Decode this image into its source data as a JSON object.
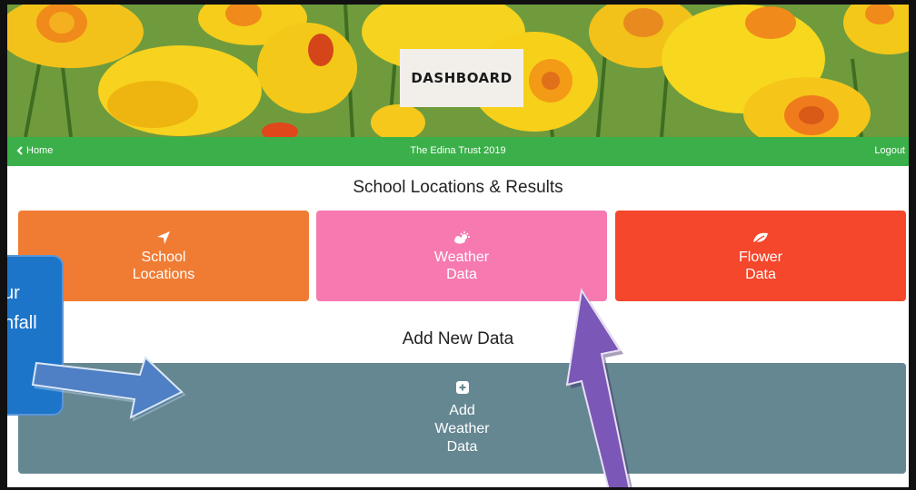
{
  "header": {
    "title": "DASHBOARD"
  },
  "nav": {
    "home_label": "Home",
    "center_text": "The Edina Trust 2019",
    "logout_label": "Logout"
  },
  "results_section": {
    "title": "School Locations & Results",
    "tiles": [
      {
        "line1": "School",
        "line2": "Locations",
        "icon": "location-arrow-icon",
        "color": "#f07c34"
      },
      {
        "line1": "Weather",
        "line2": "Data",
        "icon": "weather-icon",
        "color": "#f67ab0"
      },
      {
        "line1": "Flower",
        "line2": "Data",
        "icon": "leaf-icon",
        "color": "#f4472c"
      }
    ]
  },
  "add_section": {
    "title": "Add New Data",
    "button": {
      "line1": "Add",
      "line2": "Weather",
      "line3": "Data",
      "icon": "plus-square-icon",
      "color": "#658792"
    }
  },
  "callout": {
    "line1": "ur",
    "line2": "nfall"
  },
  "colors": {
    "nav_green": "#3bb04a",
    "blue_arrow": "#4f7fc4",
    "purple_arrow": "#7b57b7"
  }
}
